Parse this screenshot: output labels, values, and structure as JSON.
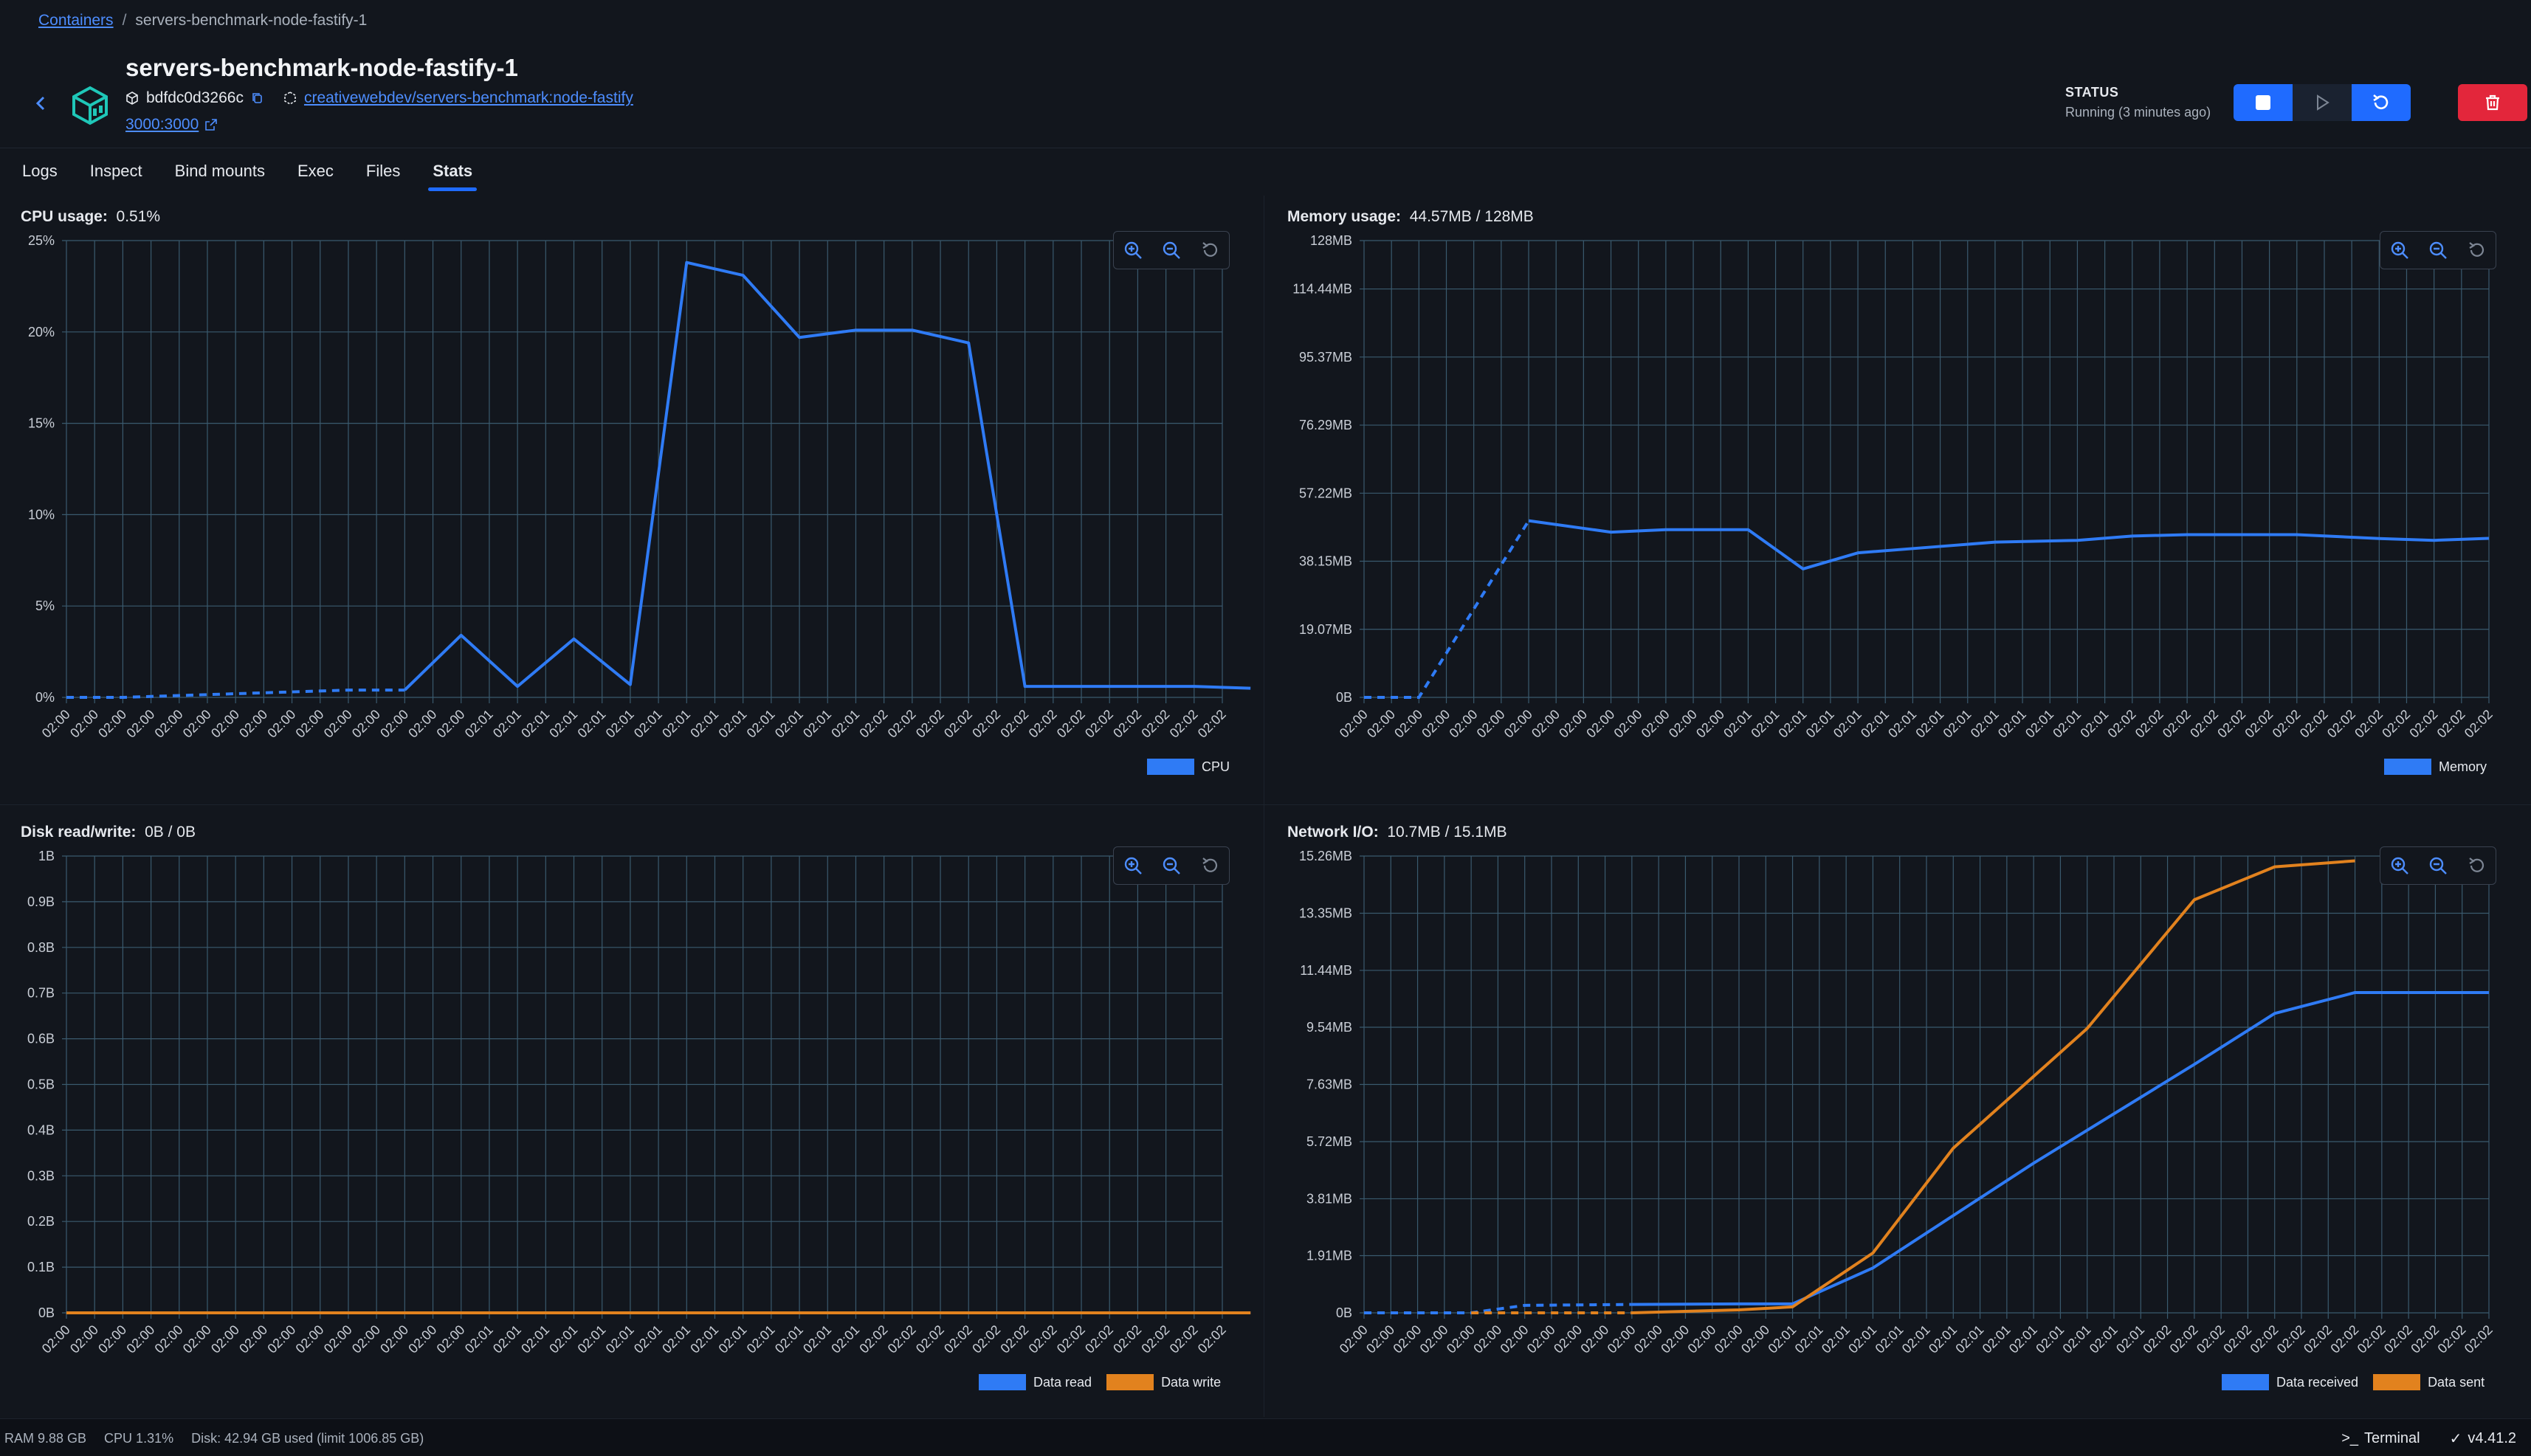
{
  "breadcrumb": {
    "root": "Containers",
    "separator": "/",
    "current": "servers-benchmark-node-fastify-1"
  },
  "container": {
    "name": "servers-benchmark-node-fastify-1",
    "id": "bdfdc0d3266c",
    "image": "creativewebdev/servers-benchmark:node-fastify",
    "port": "3000:3000"
  },
  "status": {
    "label": "STATUS",
    "value": "Running (3 minutes ago)"
  },
  "tabs": [
    {
      "label": "Logs"
    },
    {
      "label": "Inspect"
    },
    {
      "label": "Bind mounts"
    },
    {
      "label": "Exec"
    },
    {
      "label": "Files"
    },
    {
      "label": "Stats",
      "active": true
    }
  ],
  "colors": {
    "blue": "#2f7bf5",
    "orange": "#e2821e",
    "grid": "#3a5a6e"
  },
  "chart_data": [
    {
      "id": "cpu",
      "type": "line",
      "title_label": "CPU usage:",
      "title_value": "0.51%",
      "y_ticks": [
        "25%",
        "20%",
        "15%",
        "10%",
        "5%",
        "0%"
      ],
      "ylim": [
        0,
        25
      ],
      "x_labels": [
        "02:00",
        "02:00",
        "02:00",
        "02:00",
        "02:00",
        "02:00",
        "02:00",
        "02:00",
        "02:00",
        "02:00",
        "02:00",
        "02:00",
        "02:00",
        "02:00",
        "02:00",
        "02:01",
        "02:01",
        "02:01",
        "02:01",
        "02:01",
        "02:01",
        "02:01",
        "02:01",
        "02:01",
        "02:01",
        "02:01",
        "02:01",
        "02:01",
        "02:01",
        "02:02",
        "02:02",
        "02:02",
        "02:02",
        "02:02",
        "02:02",
        "02:02",
        "02:02",
        "02:02",
        "02:02",
        "02:02",
        "02:02",
        "02:02"
      ],
      "series": [
        {
          "name": "CPU",
          "color": "#2f7bf5",
          "dashed_until": 6,
          "values": [
            0,
            0,
            0.1,
            0.2,
            0.3,
            0.4,
            0.4,
            3.4,
            0.6,
            3.2,
            0.7,
            23.8,
            23.1,
            19.7,
            20.1,
            20.1,
            19.4,
            0.6,
            0.6,
            0.6,
            0.6,
            0.5
          ],
          "x_index": [
            0,
            2,
            4,
            6,
            8,
            10,
            12,
            14,
            16,
            18,
            20,
            22,
            24,
            26,
            28,
            30,
            32,
            34,
            36,
            38,
            40,
            42
          ]
        }
      ]
    },
    {
      "id": "memory",
      "type": "line",
      "title_label": "Memory usage:",
      "title_value": "44.57MB / 128MB",
      "y_ticks": [
        "128MB",
        "114.44MB",
        "95.37MB",
        "76.29MB",
        "57.22MB",
        "38.15MB",
        "19.07MB",
        "0B"
      ],
      "y_tick_values": [
        128,
        114.44,
        95.37,
        76.29,
        57.22,
        38.15,
        19.07,
        0
      ],
      "ylim": [
        0,
        128
      ],
      "x_labels": [
        "02:00",
        "02:00",
        "02:00",
        "02:00",
        "02:00",
        "02:00",
        "02:00",
        "02:00",
        "02:00",
        "02:00",
        "02:00",
        "02:00",
        "02:00",
        "02:00",
        "02:01",
        "02:01",
        "02:01",
        "02:01",
        "02:01",
        "02:01",
        "02:01",
        "02:01",
        "02:01",
        "02:01",
        "02:01",
        "02:01",
        "02:01",
        "02:01",
        "02:02",
        "02:02",
        "02:02",
        "02:02",
        "02:02",
        "02:02",
        "02:02",
        "02:02",
        "02:02",
        "02:02",
        "02:02",
        "02:02",
        "02:02",
        "02:02"
      ],
      "series": [
        {
          "name": "Memory",
          "color": "#2f7bf5",
          "dashed_until": 2,
          "values": [
            0,
            0,
            49.5,
            46.3,
            47.0,
            47.0,
            36.0,
            40.5,
            42.3,
            43.5,
            44.0,
            45.2,
            45.6,
            45.6,
            44.5,
            44.0,
            44.57
          ],
          "x_index": [
            0,
            2,
            6,
            9,
            11,
            14,
            16,
            18,
            21,
            23,
            26,
            28,
            30,
            34,
            37,
            39,
            41
          ]
        }
      ]
    },
    {
      "id": "disk",
      "type": "line",
      "title_label": "Disk read/write:",
      "title_value": "0B / 0B",
      "y_ticks": [
        "1B",
        "0.9B",
        "0.8B",
        "0.7B",
        "0.6B",
        "0.5B",
        "0.4B",
        "0.3B",
        "0.2B",
        "0.1B",
        "0B"
      ],
      "ylim": [
        0,
        1
      ],
      "x_labels": [
        "02:00",
        "02:00",
        "02:00",
        "02:00",
        "02:00",
        "02:00",
        "02:00",
        "02:00",
        "02:00",
        "02:00",
        "02:00",
        "02:00",
        "02:00",
        "02:00",
        "02:00",
        "02:01",
        "02:01",
        "02:01",
        "02:01",
        "02:01",
        "02:01",
        "02:01",
        "02:01",
        "02:01",
        "02:01",
        "02:01",
        "02:01",
        "02:01",
        "02:01",
        "02:02",
        "02:02",
        "02:02",
        "02:02",
        "02:02",
        "02:02",
        "02:02",
        "02:02",
        "02:02",
        "02:02",
        "02:02",
        "02:02",
        "02:02"
      ],
      "series": [
        {
          "name": "Data read",
          "color": "#2f7bf5",
          "dashed_until": 0,
          "values": [
            0,
            0
          ],
          "x_index": [
            0,
            42
          ]
        },
        {
          "name": "Data write",
          "color": "#e2821e",
          "dashed_until": 0,
          "values": [
            0,
            0
          ],
          "x_index": [
            0,
            42
          ]
        }
      ]
    },
    {
      "id": "network",
      "type": "line",
      "title_label": "Network I/O:",
      "title_value": "10.7MB / 15.1MB",
      "y_ticks": [
        "15.26MB",
        "13.35MB",
        "11.44MB",
        "9.54MB",
        "7.63MB",
        "5.72MB",
        "3.81MB",
        "1.91MB",
        "0B"
      ],
      "y_tick_values": [
        15.26,
        13.35,
        11.44,
        9.54,
        7.63,
        5.72,
        3.81,
        1.91,
        0
      ],
      "ylim": [
        0,
        15.26
      ],
      "x_labels": [
        "02:00",
        "02:00",
        "02:00",
        "02:00",
        "02:00",
        "02:00",
        "02:00",
        "02:00",
        "02:00",
        "02:00",
        "02:00",
        "02:00",
        "02:00",
        "02:00",
        "02:00",
        "02:00",
        "02:01",
        "02:01",
        "02:01",
        "02:01",
        "02:01",
        "02:01",
        "02:01",
        "02:01",
        "02:01",
        "02:01",
        "02:01",
        "02:01",
        "02:01",
        "02:01",
        "02:02",
        "02:02",
        "02:02",
        "02:02",
        "02:02",
        "02:02",
        "02:02",
        "02:02",
        "02:02",
        "02:02",
        "02:02",
        "02:02",
        "02:02"
      ],
      "series": [
        {
          "name": "Data received",
          "color": "#2f7bf5",
          "dashed_until": 3,
          "values": [
            0,
            0,
            0.25,
            0.28,
            0.3,
            0.3,
            1.5,
            5.0,
            8.3,
            10.0,
            10.7,
            10.7,
            10.7
          ],
          "x_index": [
            0,
            4,
            6,
            10,
            14,
            16,
            19,
            25,
            31,
            34,
            37,
            40,
            42
          ]
        },
        {
          "name": "Data sent",
          "color": "#e2821e",
          "dashed_until": 2,
          "values": [
            0,
            0,
            0,
            0.1,
            0.2,
            2.0,
            5.5,
            9.5,
            13.8,
            14.9,
            15.1
          ],
          "x_index": [
            4,
            8,
            10,
            14,
            16,
            19,
            22,
            27,
            31,
            34,
            37
          ]
        }
      ]
    }
  ],
  "footer": {
    "ram": "RAM 9.88 GB",
    "cpu": "CPU 1.31%",
    "disk": "Disk: 42.94 GB used (limit 1006.85 GB)",
    "terminal": "Terminal",
    "version": "v4.41.2"
  }
}
